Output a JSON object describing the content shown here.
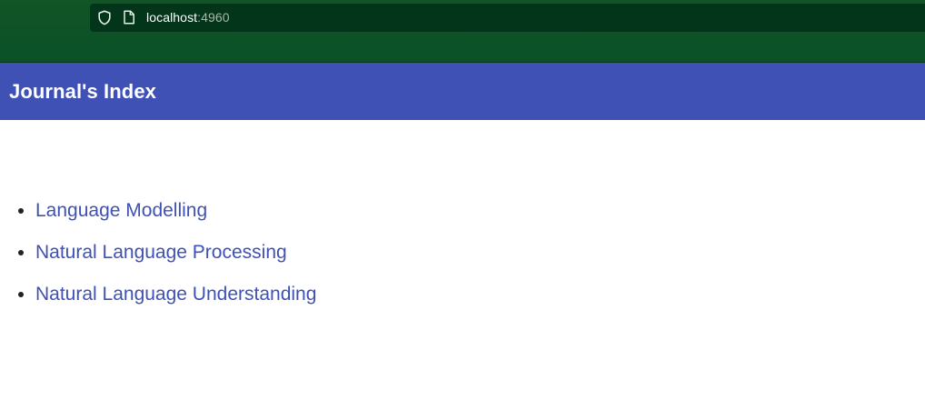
{
  "browser": {
    "url_host": "localhost",
    "url_port": ":4960",
    "icons": [
      "shield-icon",
      "page-icon"
    ]
  },
  "header": {
    "title": "Journal's Index",
    "color": "#3f51b5"
  },
  "journals": {
    "items": [
      {
        "label": "Language Modelling"
      },
      {
        "label": "Natural Language Processing"
      },
      {
        "label": "Natural Language Understanding"
      }
    ],
    "link_color": "#3f51b5"
  }
}
